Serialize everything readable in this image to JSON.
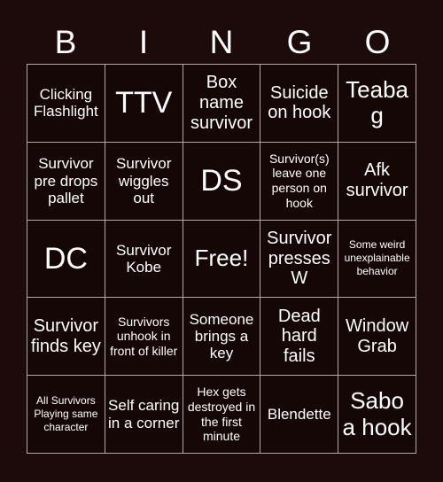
{
  "theme": {
    "page_background": "#1d0b0b",
    "cell_background": "#160707",
    "grid_line": "#b3a9a6",
    "text_color": "#ffffff"
  },
  "header": {
    "letters": [
      "B",
      "I",
      "N",
      "G",
      "O"
    ]
  },
  "grid": {
    "columns": 5,
    "rows": 5,
    "free_space": "Free!",
    "cells": [
      {
        "text": "Clicking Flashlight",
        "size": "md"
      },
      {
        "text": "TTV",
        "size": "xxl"
      },
      {
        "text": "Box name survivor",
        "size": "lg"
      },
      {
        "text": "Suicide on hook",
        "size": "lg"
      },
      {
        "text": "Teabag",
        "size": "xl"
      },
      {
        "text": "Survivor pre drops pallet",
        "size": "md"
      },
      {
        "text": "Survivor wiggles out",
        "size": "md"
      },
      {
        "text": "DS",
        "size": "xxl"
      },
      {
        "text": "Survivor(s) leave one person on hook",
        "size": "sm"
      },
      {
        "text": "Afk survivor",
        "size": "lg"
      },
      {
        "text": "DC",
        "size": "xxl"
      },
      {
        "text": "Survivor Kobe",
        "size": "md"
      },
      {
        "text": "Free!",
        "size": "xl"
      },
      {
        "text": "Survivor presses W",
        "size": "lg"
      },
      {
        "text": "Some weird unexplainable behavior",
        "size": "xs"
      },
      {
        "text": "Survivor finds key",
        "size": "lg"
      },
      {
        "text": "Survivors unhook in front of killer",
        "size": "sm"
      },
      {
        "text": "Someone brings a key",
        "size": "md"
      },
      {
        "text": "Dead hard fails",
        "size": "lg"
      },
      {
        "text": "Window Grab",
        "size": "lg"
      },
      {
        "text": "All Survivors Playing same character",
        "size": "xs"
      },
      {
        "text": "Self caring in a corner",
        "size": "md"
      },
      {
        "text": "Hex gets destroyed in the first minute",
        "size": "sm"
      },
      {
        "text": "Blendette",
        "size": "md"
      },
      {
        "text": "Sabo a hook",
        "size": "xl"
      }
    ]
  }
}
